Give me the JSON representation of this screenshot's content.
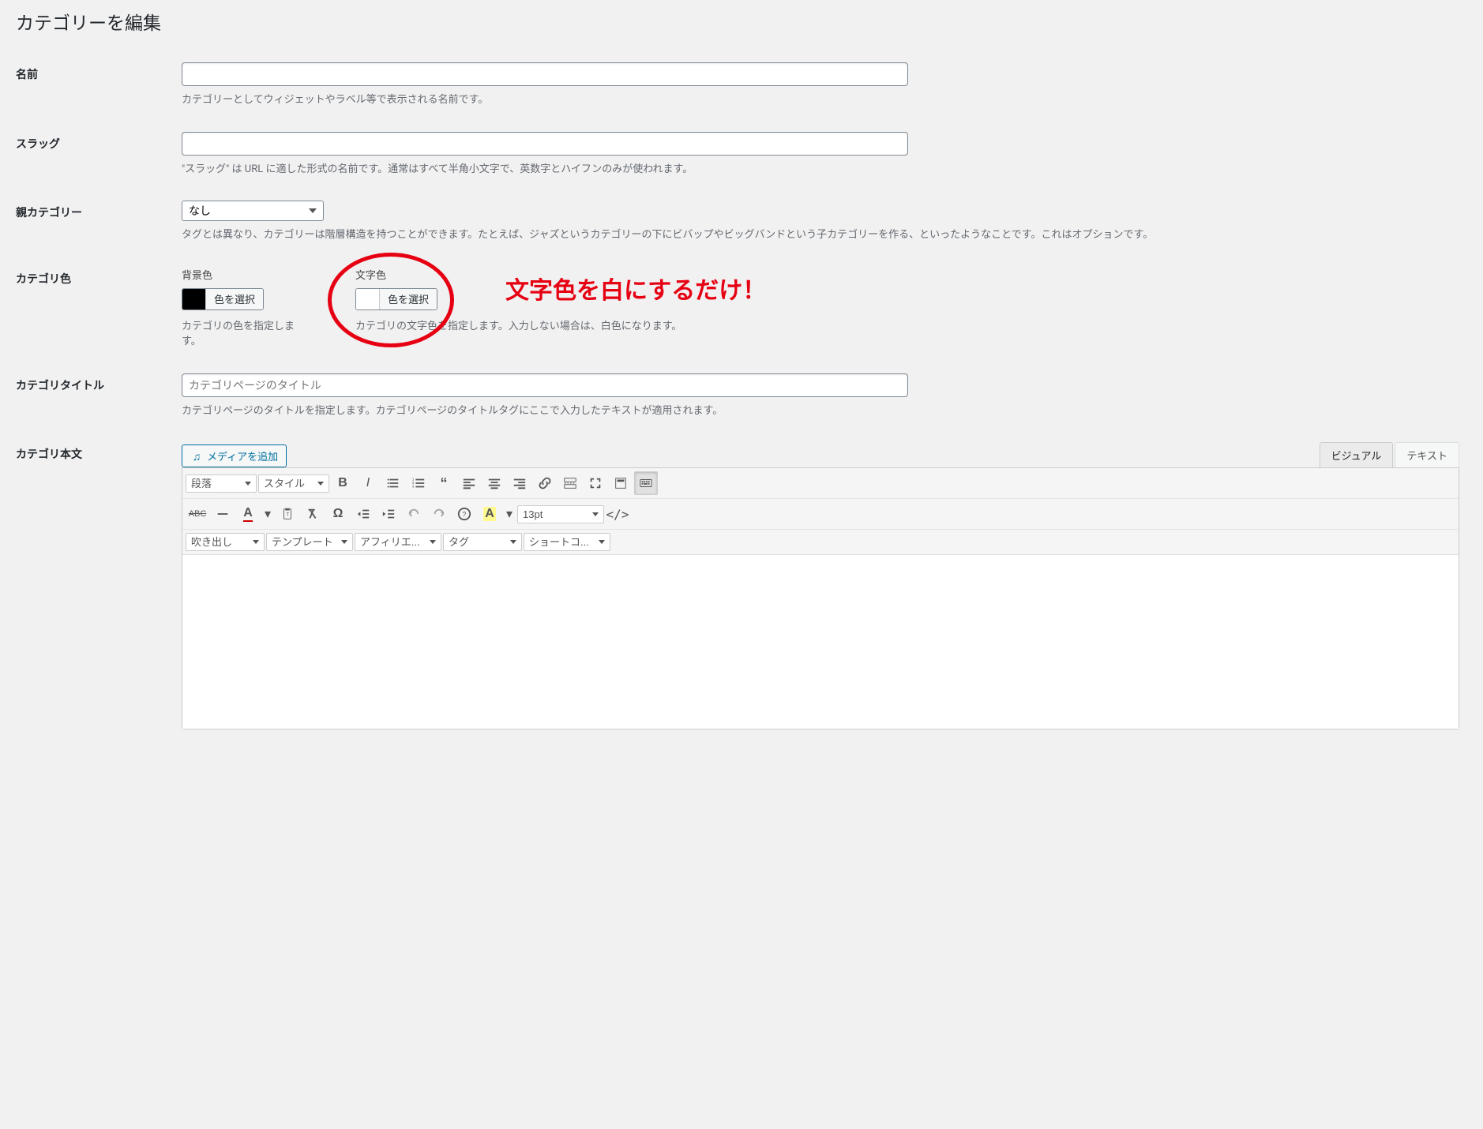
{
  "page": {
    "title": "カテゴリーを編集"
  },
  "fields": {
    "name": {
      "label": "名前",
      "value": "",
      "desc": "カテゴリーとしてウィジェットやラベル等で表示される名前です。"
    },
    "slug": {
      "label": "スラッグ",
      "value": "",
      "desc": "\"スラッグ\" は URL に適した形式の名前です。通常はすべて半角小文字で、英数字とハイフンのみが使われます。"
    },
    "parent": {
      "label": "親カテゴリー",
      "selected": "なし",
      "desc": "タグとは異なり、カテゴリーは階層構造を持つことができます。たとえば、ジャズというカテゴリーの下にビバップやビッグバンドという子カテゴリーを作る、といったようなことです。これはオプションです。"
    },
    "catcolor": {
      "label": "カテゴリ色",
      "bg": {
        "label": "背景色",
        "button": "色を選択",
        "swatch": "#000000",
        "desc": "カテゴリの色を指定します。"
      },
      "text": {
        "label": "文字色",
        "button": "色を選択",
        "swatch": "#ffffff",
        "desc": "カテゴリの文字色を指定します。入力しない場合は、白色になります。"
      },
      "annotation": "文字色を白にするだけ！"
    },
    "cattitle": {
      "label": "カテゴリタイトル",
      "placeholder": "カテゴリページのタイトル",
      "value": "",
      "desc": "カテゴリページのタイトルを指定します。カテゴリページのタイトルタグにここで入力したテキストが適用されます。"
    },
    "catbody": {
      "label": "カテゴリ本文"
    }
  },
  "editor": {
    "mediaButton": "メディアを追加",
    "tabs": {
      "visual": "ビジュアル",
      "text": "テキスト"
    },
    "row1": {
      "format": "段落",
      "style": "スタイル"
    },
    "row2": {
      "fontsize": "13pt"
    },
    "row3": {
      "dd1": "吹き出し",
      "dd2": "テンプレート",
      "dd3": "アフィリエ...",
      "dd4": "タグ",
      "dd5": "ショートコ..."
    }
  }
}
